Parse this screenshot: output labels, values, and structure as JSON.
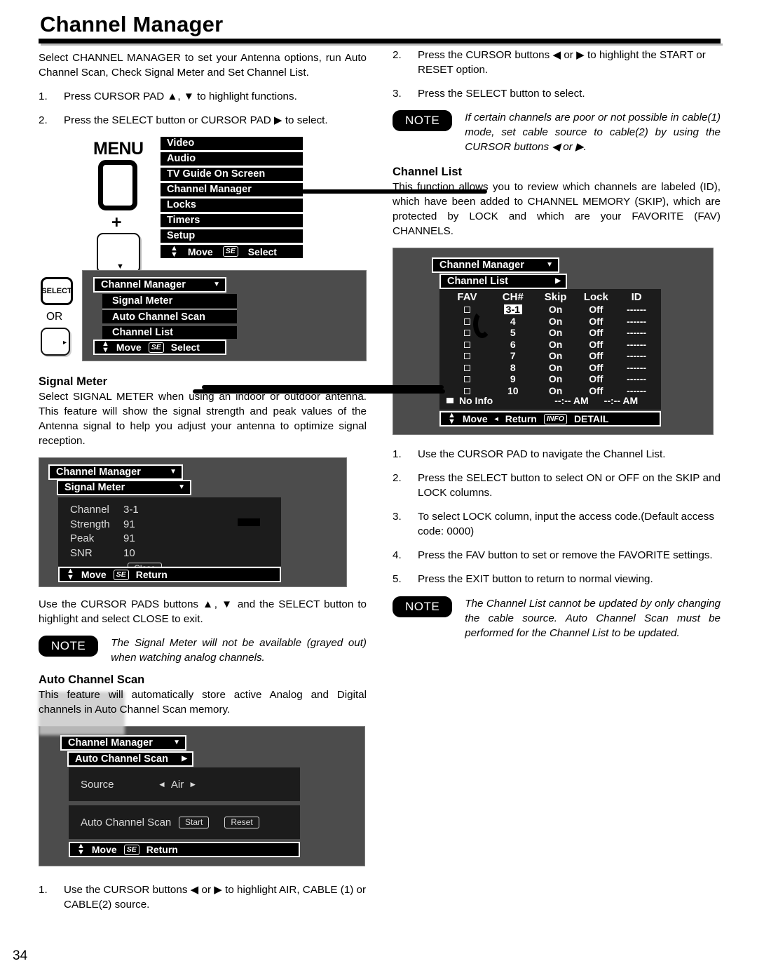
{
  "document": {
    "title": "Channel Manager",
    "page_number": "34"
  },
  "left": {
    "intro": "Select CHANNEL MANAGER to set your Antenna options, run Auto Channel Scan, Check Signal Meter and Set Channel List.",
    "steps": [
      {
        "num": "1.",
        "text": "Press CURSOR PAD ▲, ▼ to highlight functions."
      },
      {
        "num": "2.",
        "text": "Press the SELECT button or CURSOR PAD ▶ to select."
      }
    ],
    "menu_diagram": {
      "menu_label": "MENU",
      "plus": "+",
      "cursor_down_glyph": "▼",
      "items": [
        "Video",
        "Audio",
        "TV Guide On Screen",
        "Channel Manager",
        "Locks",
        "Timers",
        "Setup"
      ],
      "footer": {
        "move": "Move",
        "select_key": "SE",
        "select": "Select"
      }
    },
    "select_diagram": {
      "select_key_label": "SELECT",
      "or_label": "OR",
      "cursor_right_glyph": "▸",
      "title_bar": "Channel Manager",
      "items": [
        "Signal Meter",
        "Auto Channel Scan",
        "Channel List"
      ],
      "footer": {
        "move": "Move",
        "select_key": "SE",
        "select": "Select"
      }
    },
    "signal_meter": {
      "heading": "Signal Meter",
      "body": "Select SIGNAL METER when using an indoor or outdoor antenna. This feature will show the signal strength and peak values of the Antenna signal to help you adjust your antenna to optimize signal reception.",
      "panel": {
        "title_bar": "Channel Manager",
        "sub_bar": "Signal Meter",
        "rows": [
          {
            "label": "Channel",
            "value": "3-1"
          },
          {
            "label": "Strength",
            "value": "91"
          },
          {
            "label": "Peak",
            "value": "91"
          },
          {
            "label": "SNR",
            "value": "10"
          }
        ],
        "close_button": "Close",
        "footer": {
          "move": "Move",
          "select_key": "SE",
          "return": "Return"
        }
      },
      "after_text": "Use the CURSOR PADS buttons ▲, ▼ and the SELECT button to highlight and select CLOSE to exit.",
      "note_badge": "NOTE",
      "note_text": "The Signal Meter will not be available (grayed out) when watching analog channels."
    },
    "auto_channel_scan": {
      "heading": "Auto Channel Scan",
      "body": "This feature will automatically store active Analog and Digital channels in Auto Channel Scan memory.",
      "panel": {
        "title_bar": "Channel Manager",
        "sub_bar": "Auto Channel Scan",
        "source_label": "Source",
        "source_left_glyph": "◄",
        "source_value": "Air",
        "source_right_glyph": "►",
        "scan_label": "Auto Channel Scan",
        "start_button": "Start",
        "reset_button": "Reset",
        "footer": {
          "move": "Move",
          "select_key": "SE",
          "return": "Return"
        }
      },
      "step": {
        "num": "1.",
        "text": "Use the CURSOR buttons ◀ or ▶ to highlight AIR, CABLE (1) or CABLE(2) source."
      }
    }
  },
  "right": {
    "steps_top": [
      {
        "num": "2.",
        "text": "Press the CURSOR buttons ◀ or ▶ to highlight the START or RESET option."
      },
      {
        "num": "3.",
        "text": "Press the SELECT button to select."
      }
    ],
    "note_top": {
      "badge": "NOTE",
      "text": "If certain channels are poor or not possible in cable(1) mode, set cable source to cable(2) by using the CURSOR buttons ◀ or ▶."
    },
    "channel_list": {
      "heading": "Channel List",
      "body": "This function allows you to review which channels are labeled (ID), which have been added to CHANNEL MEMORY (SKIP), which are protected by LOCK and which are your FAVORITE (FAV) CHANNELS.",
      "panel": {
        "title_bar": "Channel Manager",
        "sub_bar": "Channel List",
        "columns": [
          "FAV",
          "CH#",
          "Skip",
          "Lock",
          "ID"
        ],
        "rows": [
          {
            "fav": "",
            "ch": "3-1",
            "selected": true,
            "skip": "On",
            "lock": "Off",
            "id": "------"
          },
          {
            "fav": "",
            "ch": "4",
            "selected": false,
            "skip": "On",
            "lock": "Off",
            "id": "------"
          },
          {
            "fav": "",
            "ch": "5",
            "selected": false,
            "skip": "On",
            "lock": "Off",
            "id": "------"
          },
          {
            "fav": "",
            "ch": "6",
            "selected": false,
            "skip": "On",
            "lock": "Off",
            "id": "------"
          },
          {
            "fav": "",
            "ch": "7",
            "selected": false,
            "skip": "On",
            "lock": "Off",
            "id": "------"
          },
          {
            "fav": "",
            "ch": "8",
            "selected": false,
            "skip": "On",
            "lock": "Off",
            "id": "------"
          },
          {
            "fav": "",
            "ch": "9",
            "selected": false,
            "skip": "On",
            "lock": "Off",
            "id": "------"
          },
          {
            "fav": "",
            "ch": "10",
            "selected": false,
            "skip": "On",
            "lock": "Off",
            "id": "------"
          }
        ],
        "status": {
          "label": "No Info",
          "time_start": "--:-- AM",
          "time_end": "--:-- AM"
        },
        "footer": {
          "move": "Move",
          "return_glyph": "◂",
          "return": "Return",
          "info_key": "INFO",
          "detail": "DETAIL"
        }
      },
      "steps": [
        {
          "num": "1.",
          "text": "Use the CURSOR PAD to navigate the Channel List."
        },
        {
          "num": "2.",
          "text": "Press the SELECT button to select ON or OFF on the SKIP and LOCK columns."
        },
        {
          "num": "3.",
          "text": "To select LOCK column, input the access code.(Default access code: 0000)"
        },
        {
          "num": "4.",
          "text": "Press the FAV button to set or remove the FAVORITE settings."
        },
        {
          "num": "5.",
          "text": "Press the EXIT button to return to normal viewing."
        }
      ],
      "note": {
        "badge": "NOTE",
        "text": "The Channel List cannot be updated by only changing the cable source. Auto Channel Scan must be performed for the Channel List to be updated."
      }
    }
  },
  "colors": {
    "osd_panel_bg": "#4c4c4c",
    "osd_body_bg": "#1c1c1c",
    "bar_bg": "#000000",
    "bar_fg": "#ffffff"
  }
}
